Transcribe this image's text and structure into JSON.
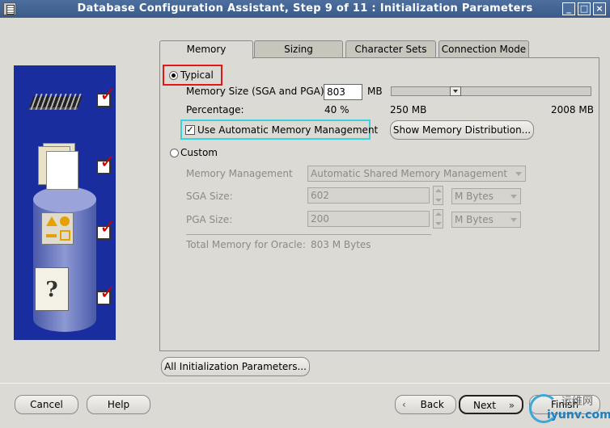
{
  "window": {
    "title": "Database Configuration Assistant, Step 9 of 11 : Initialization Parameters"
  },
  "tabs": [
    {
      "label": "Memory"
    },
    {
      "label": "Sizing"
    },
    {
      "label": "Character Sets"
    },
    {
      "label": "Connection Mode"
    }
  ],
  "memory": {
    "typical_label": "Typical",
    "memory_size_label": "Memory Size (SGA and PGA):",
    "memory_size_value": "803",
    "memory_size_unit": "MB",
    "percentage_label": "Percentage:",
    "percentage_value": "40 %",
    "slider_min": "250 MB",
    "slider_max": "2008 MB",
    "slider_fraction": 0.31,
    "use_amm_label": "Use Automatic Memory Management",
    "show_distribution_label": "Show Memory Distribution...",
    "custom_label": "Custom",
    "memory_management_label": "Memory Management",
    "memory_management_value": "Automatic Shared Memory Management",
    "sga_size_label": "SGA Size:",
    "sga_size_value": "602",
    "sga_unit": "M Bytes",
    "pga_size_label": "PGA Size:",
    "pga_size_value": "200",
    "pga_unit": "M Bytes",
    "total_memory_label": "Total Memory for Oracle:",
    "total_memory_value": "803 M Bytes"
  },
  "all_params_label": "All Initialization Parameters...",
  "footer": {
    "cancel": "Cancel",
    "help": "Help",
    "back": "Back",
    "next": "Next",
    "finish": "Finish"
  },
  "watermark": {
    "cn": "运维网",
    "url": "iyunv.com"
  }
}
